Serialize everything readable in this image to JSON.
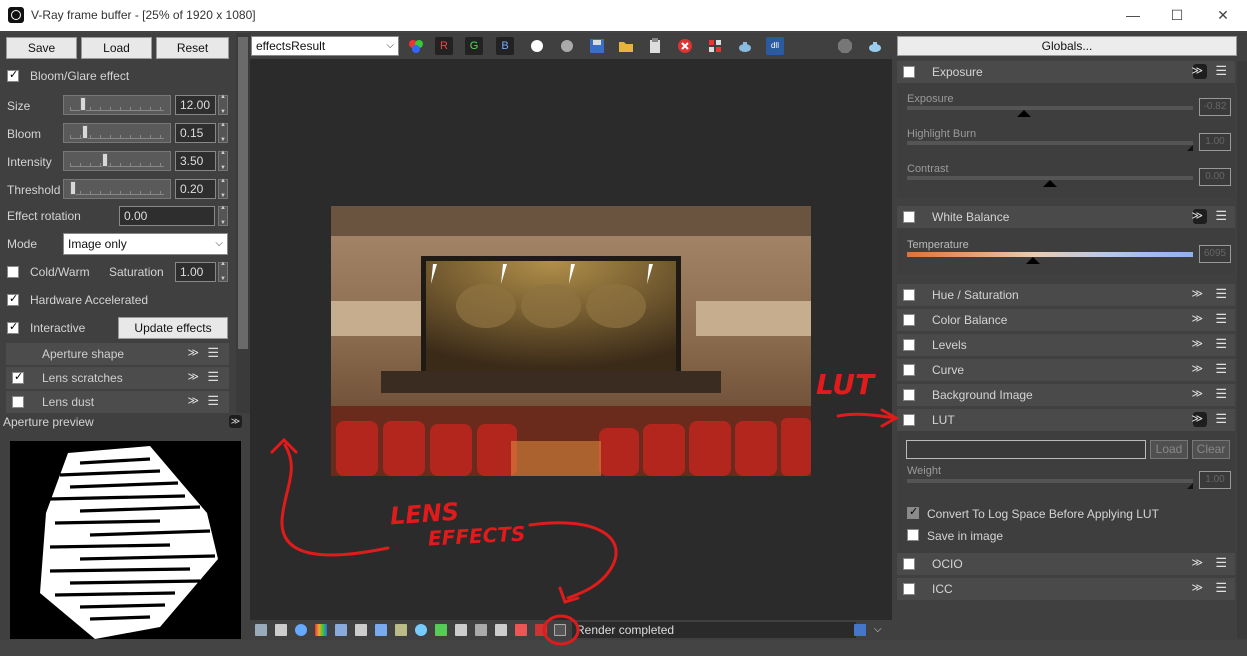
{
  "window": {
    "title": "V-Ray frame buffer - [25% of 1920 x 1080]",
    "minimize": "—",
    "maximize": "☐",
    "close": "✕"
  },
  "left": {
    "save": "Save",
    "load": "Load",
    "reset": "Reset",
    "bloom_glare": {
      "label": "Bloom/Glare effect",
      "checked": true
    },
    "sliders": [
      {
        "label": "Size",
        "value": "12.00",
        "fraction": 0.12
      },
      {
        "label": "Bloom",
        "value": "0.15",
        "fraction": 0.15
      },
      {
        "label": "Intensity",
        "value": "3.50",
        "fraction": 0.35
      },
      {
        "label": "Threshold",
        "value": "0.20",
        "fraction": 0.02
      }
    ],
    "effect_rotation": {
      "label": "Effect rotation",
      "value": "0.00"
    },
    "mode": {
      "label": "Mode",
      "value": "Image only"
    },
    "cold_warm": {
      "label": "Cold/Warm",
      "checked": false
    },
    "saturation": {
      "label": "Saturation",
      "value": "1.00"
    },
    "hardware_accelerated": {
      "label": "Hardware Accelerated",
      "checked": true
    },
    "interactive": {
      "label": "Interactive",
      "checked": true
    },
    "update_effects": "Update effects",
    "subsections": [
      {
        "label": "Aperture shape",
        "checked": null
      },
      {
        "label": "Lens scratches",
        "checked": true
      },
      {
        "label": "Lens dust",
        "checked": false
      }
    ],
    "aperture_preview": "Aperture preview"
  },
  "toolbar": {
    "channel": "effectsResult",
    "r": "R",
    "g": "G",
    "b": "B"
  },
  "status": {
    "text": "Render completed"
  },
  "right": {
    "globals": "Globals...",
    "exposure": {
      "label": "Exposure",
      "sliders": [
        {
          "label": "Exposure",
          "value": "-0.82",
          "fraction": 0.41
        },
        {
          "label": "Highlight Burn",
          "value": "1.00",
          "fraction": 1.0
        },
        {
          "label": "Contrast",
          "value": "0.00",
          "fraction": 0.5
        }
      ]
    },
    "white_balance": {
      "label": "White Balance",
      "temperature": {
        "label": "Temperature",
        "value": "6095",
        "fraction": 0.44
      }
    },
    "sections": [
      "Hue / Saturation",
      "Color Balance",
      "Levels",
      "Curve",
      "Background Image"
    ],
    "lut": {
      "label": "LUT",
      "load": "Load",
      "clear": "Clear",
      "weight": {
        "label": "Weight",
        "value": "1.00"
      },
      "convert_log": {
        "label": "Convert To Log Space Before Applying LUT",
        "checked": true
      },
      "save_in_image": {
        "label": "Save in image",
        "checked": false
      }
    },
    "bottom_sections": [
      "OCIO",
      "ICC"
    ]
  },
  "annotations": {
    "lut": "LUT",
    "lens": "LENS",
    "effects": "EFFECTS"
  },
  "colors": {
    "annotation": "#e01b1b",
    "panel": "#404040",
    "viewport": "#2b2b2b"
  }
}
